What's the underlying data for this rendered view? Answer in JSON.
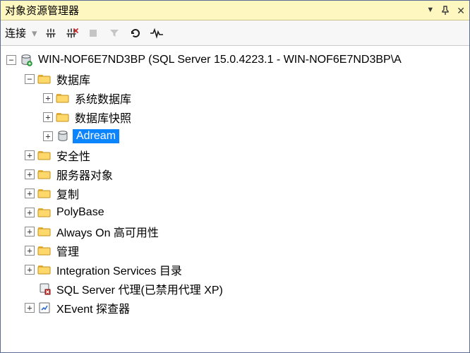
{
  "titlebar": {
    "title": "对象资源管理器"
  },
  "toolbar": {
    "connect": "连接"
  },
  "tree": {
    "server": {
      "label": "WIN-NOF6E7ND3BP (SQL Server 15.0.4223.1 - WIN-NOF6E7ND3BP\\A",
      "databases": {
        "label": "数据库",
        "sysdb": "系统数据库",
        "snapshot": "数据库快照",
        "adream": "Adream"
      },
      "security": "安全性",
      "serverobjects": "服务器对象",
      "replication": "复制",
      "polybase": "PolyBase",
      "alwayson": "Always On 高可用性",
      "management": "管理",
      "intservices": "Integration Services 目录",
      "agent": "SQL Server 代理(已禁用代理 XP)",
      "xevent": "XEvent 探查器"
    }
  }
}
